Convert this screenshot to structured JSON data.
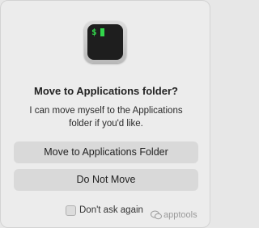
{
  "dialog": {
    "app_icon": "terminal-app-icon",
    "icon_prompt": "$",
    "title": "Move to Applications folder?",
    "message": "I can move myself to the Applications folder if you'd like.",
    "primary_button_label": "Move to Applications Folder",
    "secondary_button_label": "Do Not Move",
    "checkbox": {
      "label": "Don't ask again",
      "checked": false
    }
  },
  "watermark": {
    "text": "apptools"
  },
  "colors": {
    "background": "#ececec",
    "button": "#d9d9d9",
    "terminal_green": "#32d74b"
  }
}
